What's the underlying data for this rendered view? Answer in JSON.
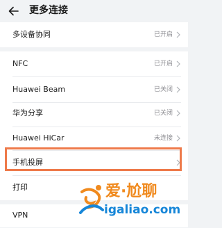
{
  "header": {
    "title": "更多连接"
  },
  "rows": [
    {
      "label": "多设备协同",
      "status": "已开启"
    },
    {
      "label": "NFC",
      "status": "已开启"
    },
    {
      "label": "Huawei Beam",
      "status": "已关闭"
    },
    {
      "label": "华为分享",
      "status": "已关闭"
    },
    {
      "label": "Huawei HiCar",
      "status": "未连接"
    },
    {
      "label": "手机投屏",
      "status": ""
    },
    {
      "label": "打印",
      "status": ""
    },
    {
      "label": "VPN",
      "status": ""
    }
  ],
  "watermark": {
    "brand": "爱·尬聊",
    "url": "igaliao.com"
  },
  "colors": {
    "background": "#f1f3f5",
    "highlight": "#ee7a4a",
    "watermark_orange": "#f08a1e",
    "watermark_blue": "#1686d8"
  }
}
